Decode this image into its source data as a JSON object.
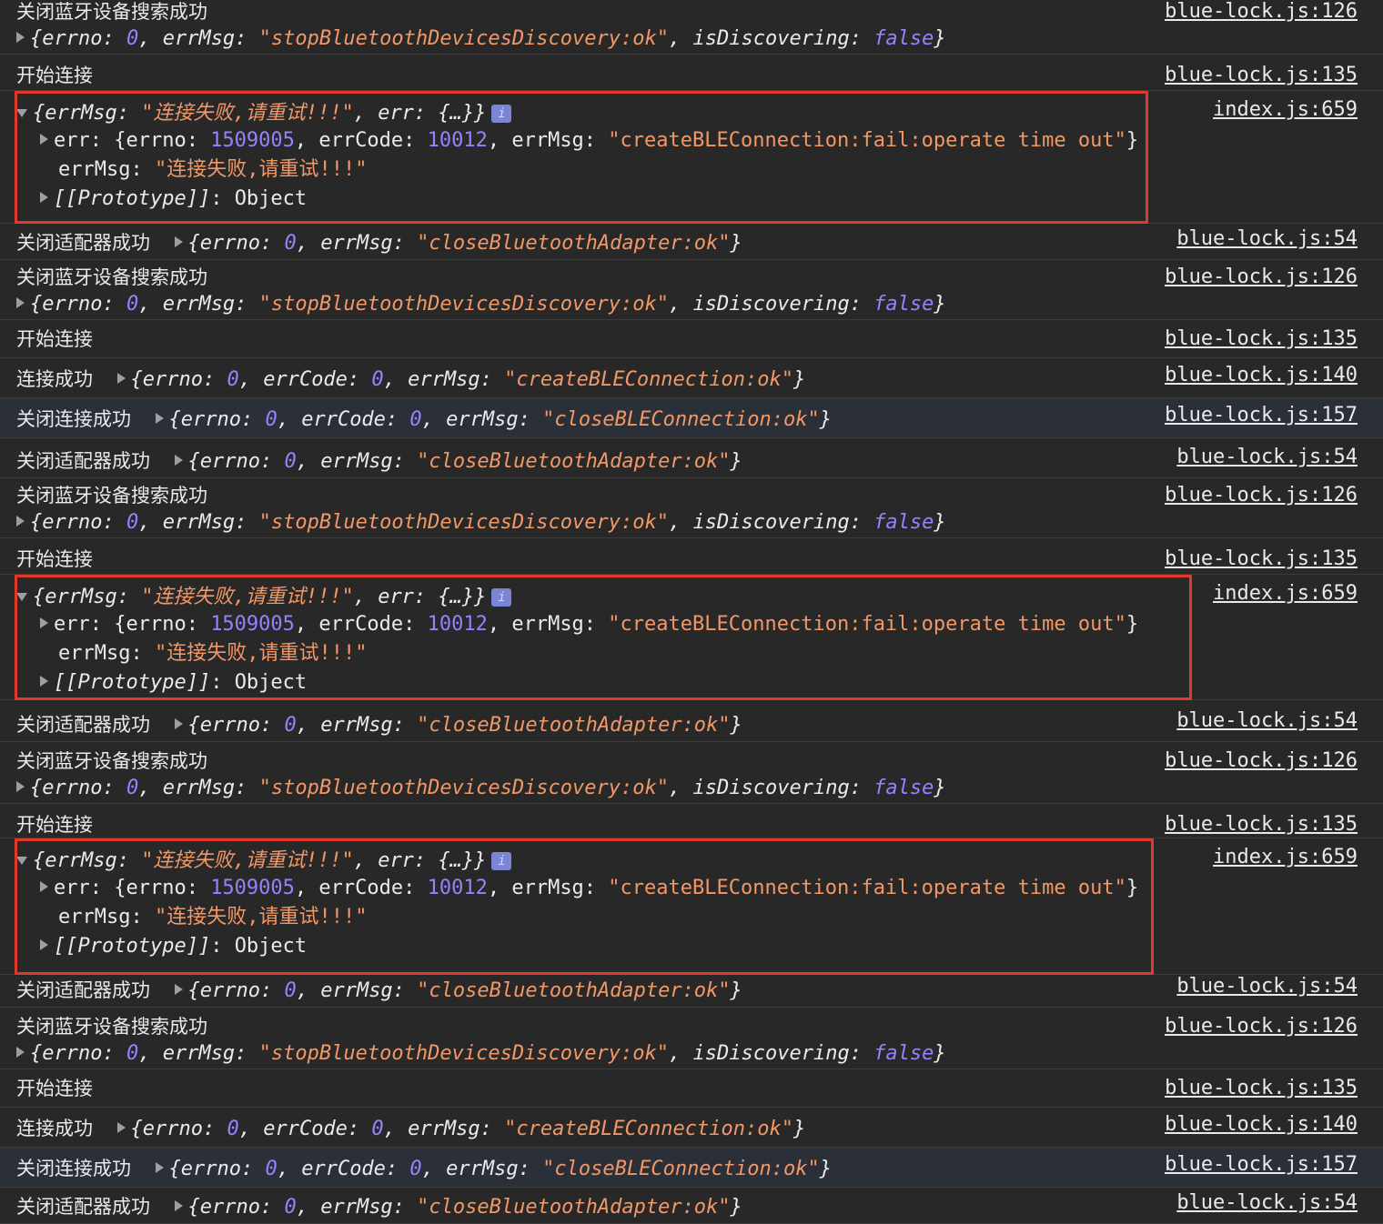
{
  "logs": {
    "stop_discovery_label": "关闭蓝牙设备搜索成功",
    "stop_discovery_obj": {
      "errno_val": "0",
      "errMsg_val": "\"stopBluetoothDevicesDiscovery:ok\"",
      "isDiscovering_val": "false"
    },
    "start_connect_label": "开始连接",
    "close_adapter_label": "关闭适配器成功",
    "close_adapter_obj": {
      "errno_val": "0",
      "errMsg_val": "\"closeBluetoothAdapter:ok\""
    },
    "connect_success_label": "连接成功",
    "connect_success_obj": {
      "errno_val": "0",
      "errCode_val": "0",
      "errMsg_val": "\"createBLEConnection:ok\""
    },
    "close_connect_label": "关闭连接成功",
    "close_connect_obj": {
      "errno_val": "0",
      "errCode_val": "0",
      "errMsg_val": "\"closeBLEConnection:ok\""
    },
    "error_obj": {
      "summary_errMsg_val": "\"连接失败,请重试!!!\"",
      "summary_err_val": "{…}",
      "err_line": {
        "errno_val": "1509005",
        "errCode_val": "10012",
        "errMsg_val": "\"createBLEConnection:fail:operate time out\""
      },
      "errMsg_line_val": "\"连接失败,请重试!!!\"",
      "prototype_key": "[[Prototype]]",
      "prototype_val": "Object",
      "info_badge": "i"
    }
  },
  "sources": {
    "s126": "blue-lock.js:126",
    "s135": "blue-lock.js:135",
    "s659": "index.js:659",
    "s54": "blue-lock.js:54",
    "s140": "blue-lock.js:140",
    "s157": "blue-lock.js:157"
  },
  "colors": {
    "background": "#282828",
    "string": "#f29766",
    "number": "#9980ff",
    "highlight_box": "#e0392b"
  }
}
